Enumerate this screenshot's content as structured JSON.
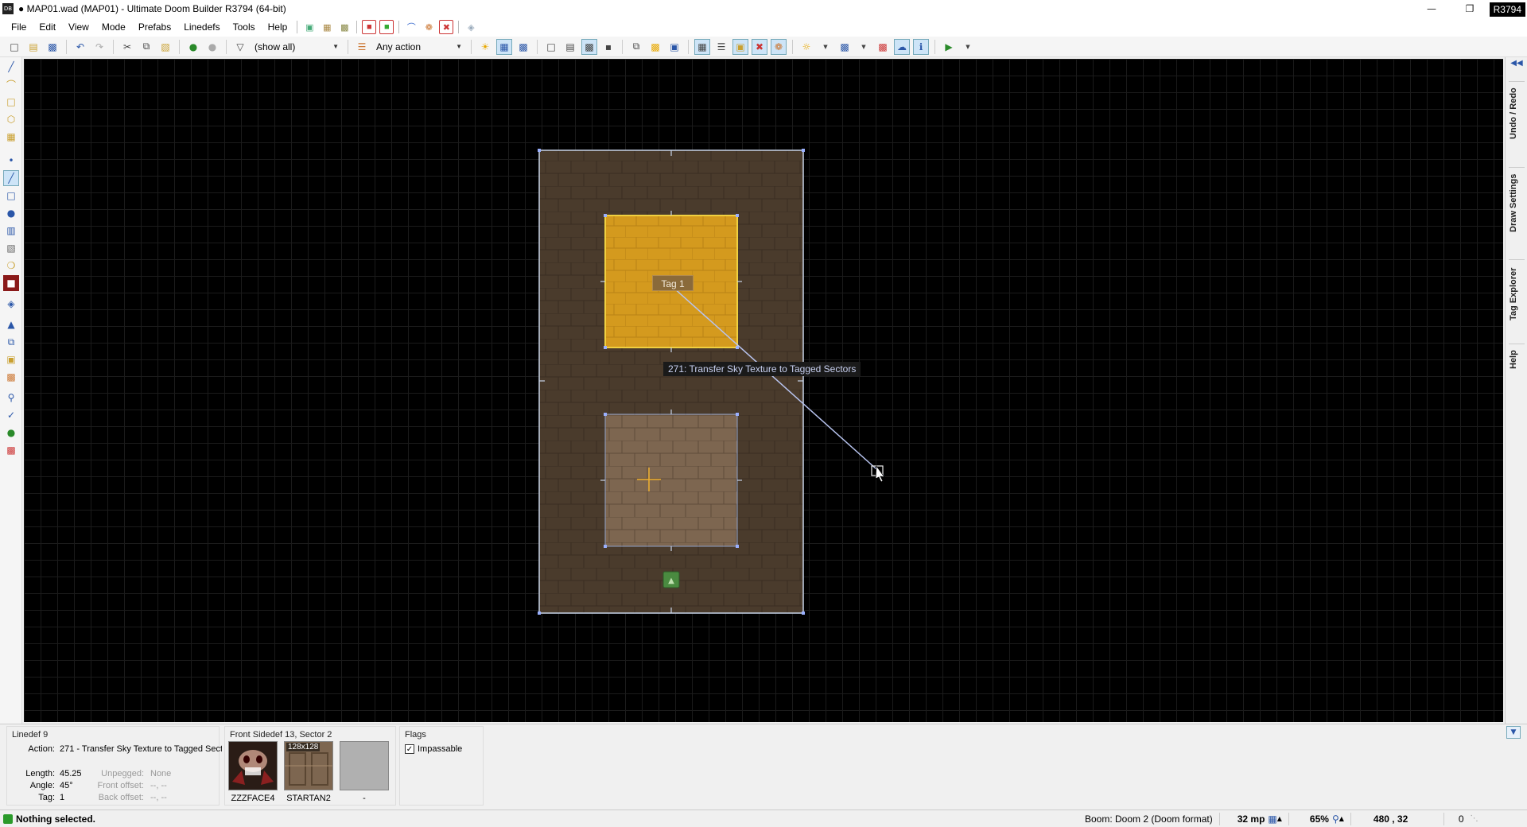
{
  "window": {
    "title": "● MAP01.wad (MAP01) - Ultimate Doom Builder R3794 (64-bit)",
    "app_icon": "DB",
    "revision_badge": "R3794",
    "minimize": "—",
    "restore": "❐"
  },
  "menubar": {
    "items": [
      "File",
      "Edit",
      "View",
      "Mode",
      "Prefabs",
      "Linedefs",
      "Tools",
      "Help"
    ]
  },
  "toolbar": {
    "filter_label": "(show all)",
    "action_label": "Any action"
  },
  "map": {
    "tag_label": "Tag 1",
    "action_label": "271: Transfer Sky Texture to Tagged Sectors",
    "colors": {
      "outer_sector": "#4a3b2c",
      "outer_border": "#c8d4e8",
      "tagged_sector": "#d49a1e",
      "tagged_border": "#f0d040",
      "lower_sector": "#7d6650",
      "line": "#b8c4f0",
      "thing": "#4a8a40"
    }
  },
  "right_dock": {
    "tabs": [
      "Undo / Redo",
      "Draw Settings",
      "Tag Explorer",
      "Help"
    ]
  },
  "info": {
    "linedef": {
      "title": "Linedef 9",
      "action_label": "Action:",
      "action_value": "271 - Transfer Sky Texture to Tagged Sect",
      "length_label": "Length:",
      "length_value": "45.25",
      "angle_label": "Angle:",
      "angle_value": "45°",
      "tag_label": "Tag:",
      "tag_value": "1",
      "unpegged_label": "Unpegged:",
      "unpegged_value": "None",
      "front_offset_label": "Front offset:",
      "front_offset_value": "--, --",
      "back_offset_label": "Back offset:",
      "back_offset_value": "--, --"
    },
    "sidedef": {
      "title": "Front Sidedef 13, Sector 2",
      "textures": [
        {
          "name": "ZZZFACE4",
          "size": ""
        },
        {
          "name": "STARTAN2",
          "size": "128x128"
        },
        {
          "name": "-",
          "size": ""
        }
      ]
    },
    "flags": {
      "title": "Flags",
      "items": [
        {
          "label": "Impassable",
          "checked": true
        }
      ]
    }
  },
  "statusbar": {
    "message": "Nothing selected.",
    "format": "Boom: Doom 2 (Doom format)",
    "grid": "32 mp",
    "zoom": "65%",
    "coords": "480 , 32",
    "count": "0"
  }
}
